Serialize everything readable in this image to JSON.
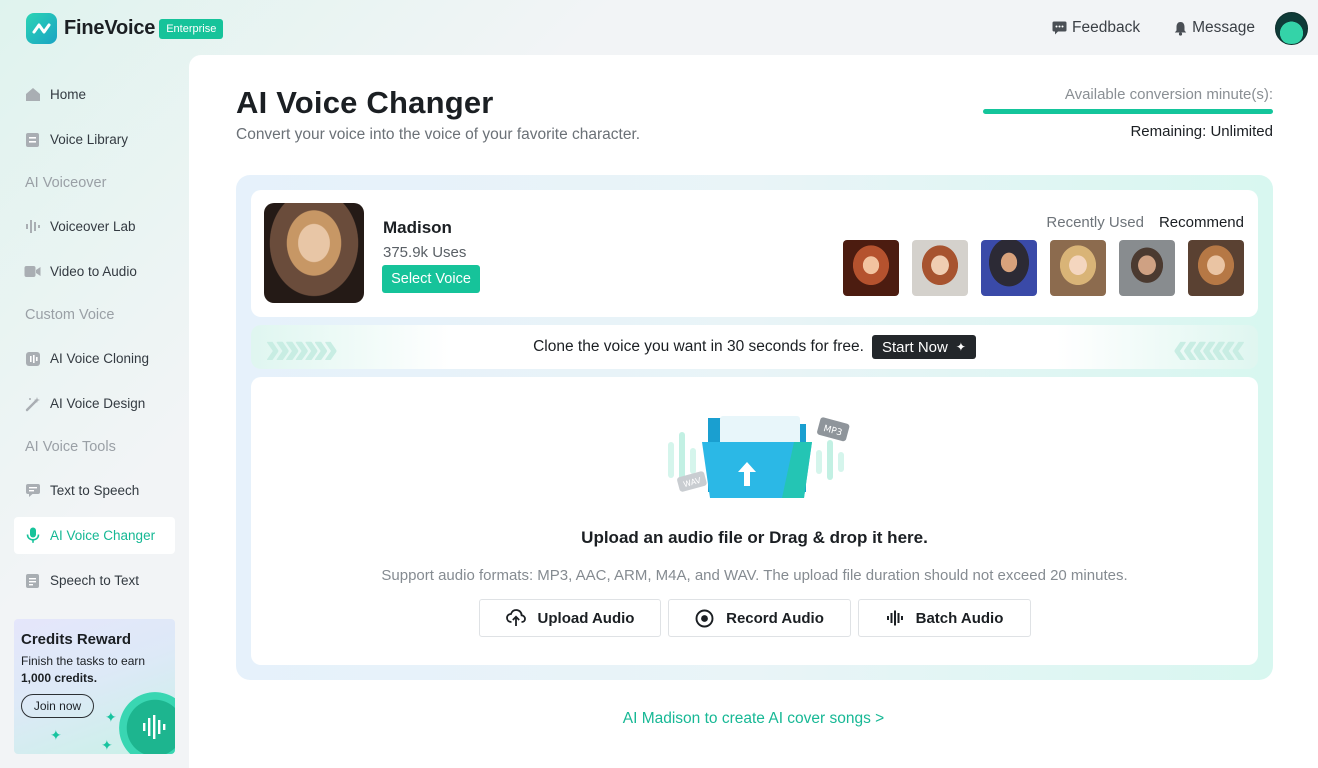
{
  "brand": {
    "name": "FineVoice",
    "badge": "Enterprise"
  },
  "top_actions": {
    "feedback": "Feedback",
    "message": "Message"
  },
  "sidebar": {
    "items": [
      {
        "label": "Home",
        "icon": "home-icon"
      },
      {
        "label": "Voice Library",
        "icon": "library-icon"
      },
      {
        "label": "Voiceover Lab",
        "icon": "waveform-icon"
      },
      {
        "label": "Video to Audio",
        "icon": "video-icon"
      },
      {
        "label": "AI Voice Cloning",
        "icon": "clone-icon"
      },
      {
        "label": "AI Voice Design",
        "icon": "magic-wand-icon"
      },
      {
        "label": "Text to Speech",
        "icon": "chat-icon"
      },
      {
        "label": "AI Voice Changer",
        "icon": "microphone-icon"
      },
      {
        "label": "Speech to Text",
        "icon": "document-icon"
      }
    ],
    "sections": {
      "voiceover": "AI Voiceover",
      "custom": "Custom Voice",
      "tools": "AI Voice Tools"
    },
    "reward": {
      "title": "Credits Reward",
      "desc_prefix": "Finish the tasks to earn",
      "desc_bold": "1,000 credits.",
      "button": "Join now"
    }
  },
  "page": {
    "title": "AI Voice Changer",
    "subtitle": "Convert your voice into the voice of your favorite character."
  },
  "quota": {
    "label": "Available conversion minute(s):",
    "remaining": "Remaining: Unlimited",
    "fill": 1.0,
    "color": "#14c59b"
  },
  "voice": {
    "name": "Madison",
    "uses": "375.9k Uses",
    "select_label": "Select Voice",
    "tabs": [
      "Recently Used",
      "Recommend"
    ],
    "active_tab": "Recommend"
  },
  "clone": {
    "text": "Clone the voice you want in 30 seconds for free.",
    "button": "Start Now"
  },
  "upload": {
    "title": "Upload an audio file or Drag & drop it here.",
    "desc": "Support audio formats: MP3, AAC, ARM, M4A, and WAV. The upload file duration should not exceed 20 minutes.",
    "buttons": [
      "Upload Audio",
      "Record Audio",
      "Batch Audio"
    ],
    "tags": {
      "mp3": "MP3",
      "wav": "WAV"
    }
  },
  "cover_link": "AI Madison to create AI cover songs >",
  "colors": {
    "accent": "#16c39a",
    "link": "#17b895"
  }
}
